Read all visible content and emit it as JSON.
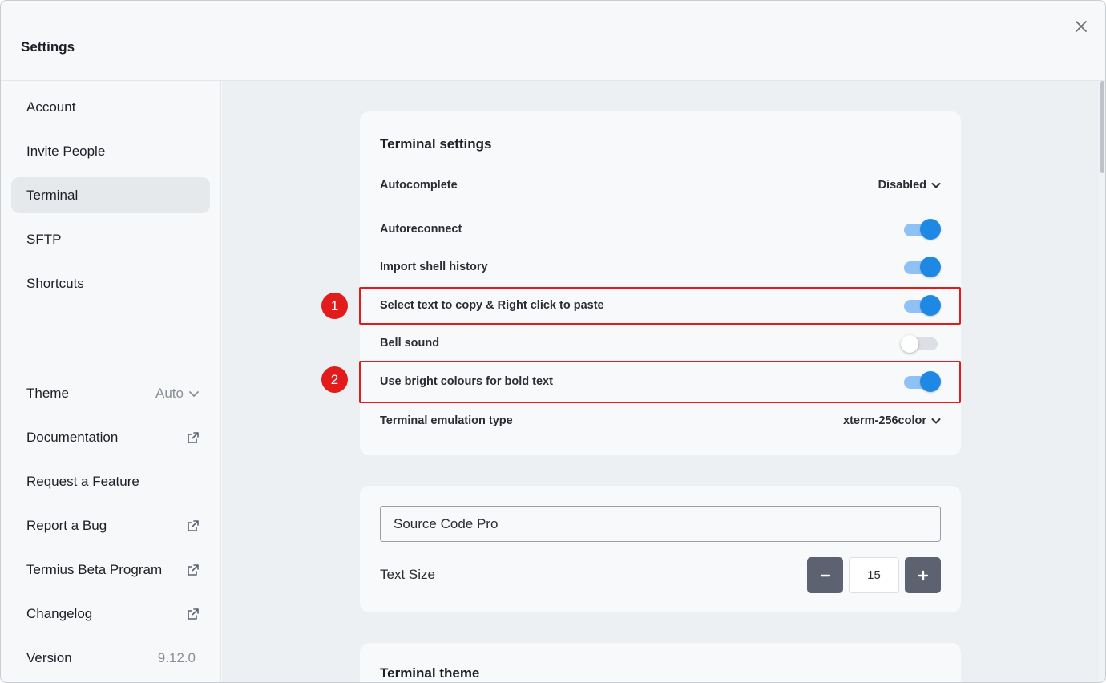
{
  "header": {
    "title": "Settings"
  },
  "sidebar": {
    "items": [
      {
        "label": "Account"
      },
      {
        "label": "Invite People"
      },
      {
        "label": "Terminal",
        "active": true
      },
      {
        "label": "SFTP"
      },
      {
        "label": "Shortcuts"
      }
    ],
    "theme": {
      "label": "Theme",
      "value": "Auto"
    },
    "links": [
      {
        "label": "Documentation",
        "icon": "external-link-icon"
      },
      {
        "label": "Request a Feature"
      },
      {
        "label": "Report a Bug",
        "icon": "external-link-icon"
      },
      {
        "label": "Termius Beta Program",
        "icon": "external-link-icon"
      },
      {
        "label": "Changelog",
        "icon": "external-link-icon"
      }
    ],
    "version": {
      "label": "Version",
      "value": "9.12.0"
    }
  },
  "terminal_settings": {
    "title": "Terminal settings",
    "autocomplete": {
      "label": "Autocomplete",
      "value": "Disabled"
    },
    "autoreconnect": {
      "label": "Autoreconnect",
      "enabled": true
    },
    "import_history": {
      "label": "Import shell history",
      "enabled": true
    },
    "select_copy": {
      "label": "Select text to copy & Right click to paste",
      "enabled": true
    },
    "bell": {
      "label": "Bell sound",
      "enabled": false
    },
    "bright_bold": {
      "label": "Use bright colours for bold text",
      "enabled": true
    },
    "emulation": {
      "label": "Terminal emulation type",
      "value": "xterm-256color"
    }
  },
  "annotations": {
    "marker1": "1",
    "marker2": "2",
    "color": "#e21b1b"
  },
  "font_settings": {
    "font_value": "Source Code Pro",
    "text_size_label": "Text Size",
    "text_size_value": "15",
    "decrease_symbol": "−",
    "increase_symbol": "+"
  },
  "theme_section": {
    "title": "Terminal theme"
  },
  "colors": {
    "accent": "#1e88e5",
    "toggle_track": "#8ec2f5",
    "highlight": "#e21b1b"
  }
}
